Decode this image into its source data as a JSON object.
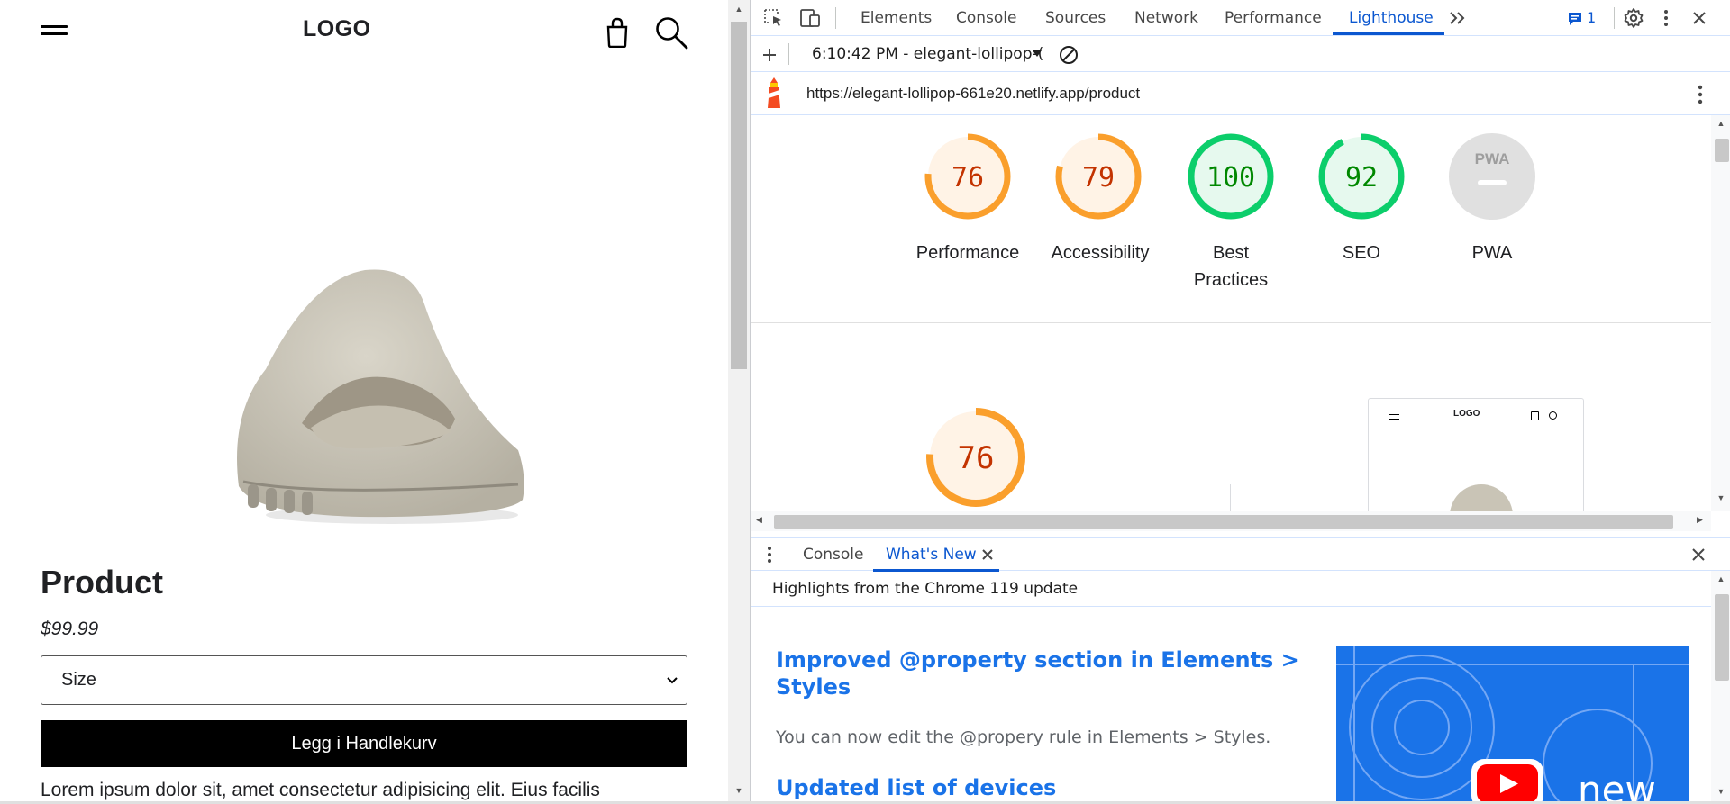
{
  "site": {
    "logo": "LOGO",
    "product_title": "Product",
    "price": "$99.99",
    "size_select": "Size",
    "add_to_cart": "Legg i Handlekurv",
    "description": "Lorem ipsum dolor sit, amet consectetur adipisicing elit. Eius facilis"
  },
  "devtools": {
    "tabs": [
      "Elements",
      "Console",
      "Sources",
      "Network",
      "Performance",
      "Lighthouse"
    ],
    "active_tab": "Lighthouse",
    "issues_count": "1",
    "report_selector": "6:10:42 PM - elegant-lollipop-(",
    "url": "https://elegant-lollipop-661e20.netlify.app/product",
    "scores": [
      {
        "label": "Performance",
        "value": 76,
        "color": "#fa9f2c"
      },
      {
        "label": "Accessibility",
        "value": 79,
        "color": "#fa9f2c"
      },
      {
        "label": "Best Practices",
        "value": 100,
        "color": "#0cce6b"
      },
      {
        "label": "SEO",
        "value": 92,
        "color": "#0cce6b"
      },
      {
        "label": "PWA",
        "value": null,
        "color": "#bdbdbd"
      }
    ],
    "pwa_badge": "PWA",
    "big_score": 76,
    "thumbnail_logo": "LOGO",
    "drawer": {
      "tabs": [
        "Console",
        "What's New"
      ],
      "active_tab": "What's New",
      "highlights": "Highlights from the Chrome 119 update",
      "heading1": "Improved @property section in Elements > Styles",
      "heading1_line1": "Improved @property section in Elements >",
      "heading1_line2": "Styles",
      "paragraph1": "You can now edit the @propery rule in Elements > Styles.",
      "heading2": "Updated list of devices",
      "video_word": "new"
    }
  },
  "colors": {
    "accent": "#0b57d0",
    "link": "#1a73e8",
    "average": "#fa9f2c",
    "good": "#0cce6b",
    "average_text": "#c33300",
    "good_text": "#008800"
  }
}
